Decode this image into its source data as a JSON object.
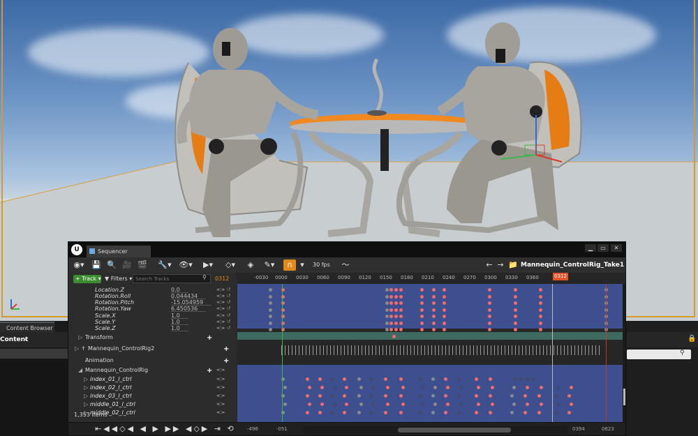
{
  "content_browser": {
    "tab_label": "Content Browser 2",
    "path_label": "Content",
    "item_count": "1,353 items"
  },
  "sequencer": {
    "tab_label": "Sequencer",
    "fps": "30 fps",
    "sequence_name": "Mannequin_ControlRig_Take1",
    "add_track_label": "Track",
    "filters_label": "Filters",
    "search_placeholder": "Search Tracks",
    "current_frame": "0312",
    "playhead_label": "0312",
    "tick_labels": [
      "-0030",
      "0000",
      "0030",
      "0060",
      "0090",
      "0120",
      "0150",
      "0180",
      "0210",
      "0240",
      "0270",
      "0300",
      "0330",
      "0360"
    ],
    "properties": [
      {
        "name": "Location.Z",
        "value": "0.0"
      },
      {
        "name": "Rotation.Roll",
        "value": "0.044434"
      },
      {
        "name": "Rotation.Pitch",
        "value": "-15.054959"
      },
      {
        "name": "Rotation.Yaw",
        "value": "6.450536"
      },
      {
        "name": "Scale.X",
        "value": "1.0"
      },
      {
        "name": "Scale.Y",
        "value": "1.0"
      },
      {
        "name": "Scale.Z",
        "value": "1.0"
      }
    ],
    "transform_label": "Transform",
    "control_rig_label": "Mannequin_ControlRig2",
    "animation_label": "Animation",
    "control_rig_section": "Mannequin_ControlRig",
    "controls": [
      "index_01_l_ctrl",
      "index_02_l_ctrl",
      "index_03_l_ctrl",
      "middle_01_l_ctrl",
      "middle_02_l_ctrl"
    ],
    "range_start_outer": "-496",
    "range_start_inner": "-051",
    "range_end_inner": "0394",
    "range_end_outer": "0623",
    "accent_color": "#e08a1d",
    "key_color": "#f26b6b"
  }
}
